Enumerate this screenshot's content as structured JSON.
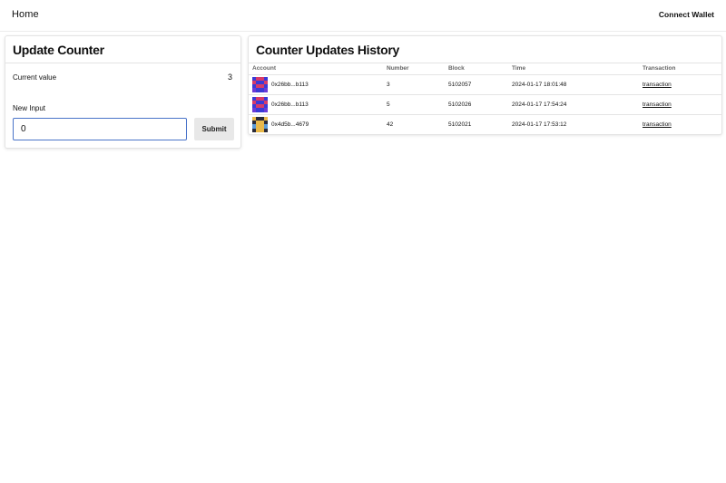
{
  "nav": {
    "home_label": "Home",
    "connect_label": "Connect Wallet"
  },
  "update_card": {
    "title": "Update Counter",
    "current_label": "Current value",
    "current_value": "3",
    "input_label": "New Input",
    "input_value": "0",
    "submit_label": "Submit"
  },
  "history_card": {
    "title": "Counter Updates History",
    "columns": [
      "Account",
      "Number",
      "Block",
      "Time",
      "Transaction"
    ],
    "rows": [
      {
        "account": "0x26bb...b113",
        "number": "3",
        "block": "5102057",
        "time": "2024-01-17 18:01:48",
        "tx": "transaction",
        "avatar": "blue-red"
      },
      {
        "account": "0x26bb...b113",
        "number": "5",
        "block": "5102026",
        "time": "2024-01-17 17:54:24",
        "tx": "transaction",
        "avatar": "blue-red"
      },
      {
        "account": "0x4d5b...4679",
        "number": "42",
        "block": "5102021",
        "time": "2024-01-17 17:53:12",
        "tx": "transaction",
        "avatar": "yellow-dark"
      }
    ]
  },
  "avatars": {
    "blue-red": [
      "#3a3ad6",
      "#d63a6a",
      "#d63a6a",
      "#3a3ad6",
      "#d63a6a",
      "#3a3ad6",
      "#3a3ad6",
      "#d63a6a",
      "#3a3ad6",
      "#d63a6a",
      "#d63a6a",
      "#3a3ad6",
      "#6a3ad6",
      "#3a3ad6",
      "#3a3ad6",
      "#6a3ad6"
    ],
    "yellow-dark": [
      "#e8b84a",
      "#2a2a38",
      "#2a2a38",
      "#e8b84a",
      "#2a2a38",
      "#e8b84a",
      "#e8b84a",
      "#2a2a38",
      "#5a9ad8",
      "#e8b84a",
      "#e8b84a",
      "#5a9ad8",
      "#2a2a38",
      "#e8b84a",
      "#e8b84a",
      "#2a2a38"
    ]
  }
}
